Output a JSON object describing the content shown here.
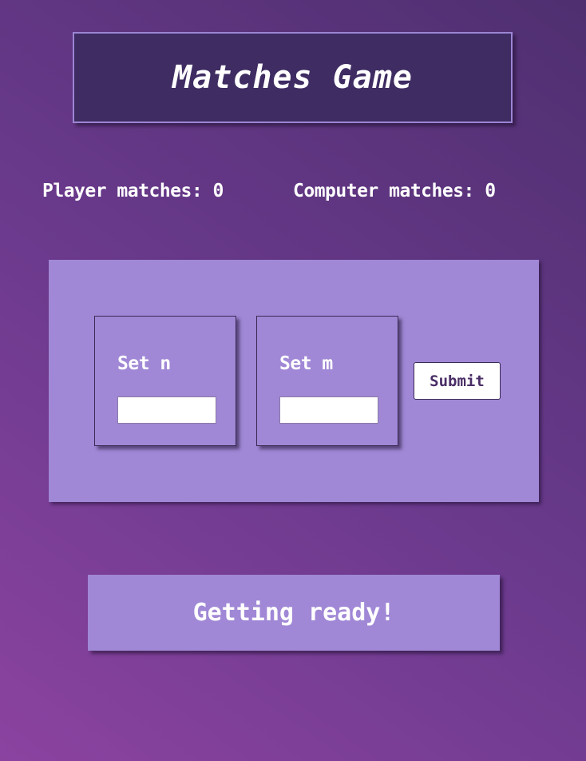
{
  "header": {
    "title": "Matches Game"
  },
  "scores": {
    "player_label": "Player matches: 0",
    "computer_label": "Computer matches: 0"
  },
  "form": {
    "n_label": "Set n",
    "n_value": "",
    "m_label": "Set m",
    "m_value": "",
    "submit_label": "Submit"
  },
  "status": {
    "message": "Getting ready!"
  },
  "colors": {
    "background_gradient": [
      "#8b43a0",
      "#4f2f70"
    ],
    "title_box": "#3e2c62",
    "panel": "#a088d6",
    "text": "#ffffff",
    "button_text": "#4a2e66"
  }
}
